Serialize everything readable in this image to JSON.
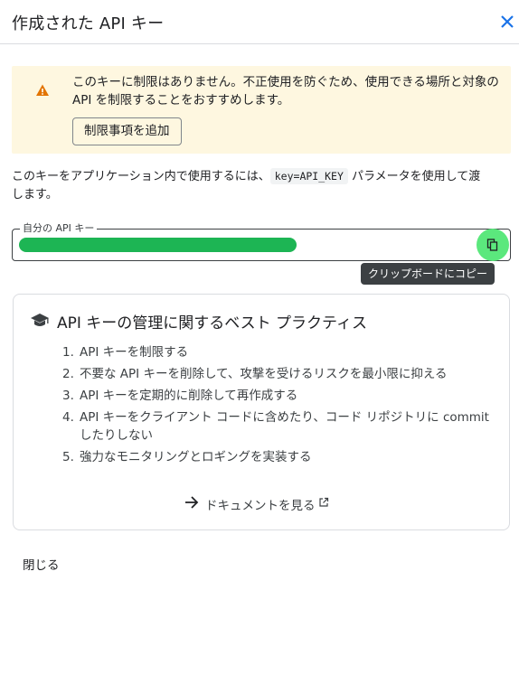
{
  "dialog": {
    "title": "作成された API キー",
    "close_icon": "close-icon"
  },
  "warning": {
    "icon": "warning-icon",
    "text": "このキーに制限はありません。不正使用を防ぐため、使用できる場所と対象の API を制限することをおすすめします。",
    "button_label": "制限事項を追加"
  },
  "usage": {
    "before": "このキーをアプリケーション内で使用するには、",
    "code": "key=API_KEY",
    "after": " パラメータを使用して渡します。"
  },
  "key_field": {
    "label": "自分の API キー",
    "copy_icon": "copy-icon",
    "tooltip": "クリップボードにコピー"
  },
  "best_practices": {
    "icon": "graduation-cap-icon",
    "title": "API キーの管理に関するベスト プラクティス",
    "items": [
      {
        "num": "1.",
        "text": "API キーを制限する"
      },
      {
        "num": "2.",
        "text": "不要な API キーを削除して、攻撃を受けるリスクを最小限に抑える"
      },
      {
        "num": "3.",
        "text": "API キーを定期的に削除して再作成する"
      },
      {
        "num": "4.",
        "text": "API キーをクライアント コードに含めたり、コード リポジトリに commit したりしない"
      },
      {
        "num": "5.",
        "text": "強力なモニタリングとロギングを実装する"
      }
    ],
    "docs_link": "ドキュメントを見る"
  },
  "footer": {
    "close_label": "閉じる"
  },
  "colors": {
    "redaction": "#1db554",
    "copy_highlight": "#5be87d",
    "warning_bg": "#fef7e0",
    "warning_icon": "#e37400",
    "close_x": "#1a73e8"
  }
}
